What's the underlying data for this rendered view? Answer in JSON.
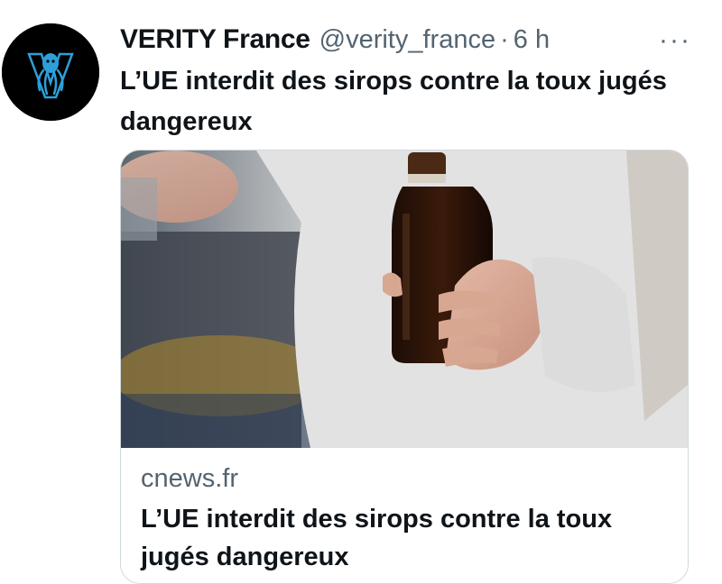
{
  "tweet": {
    "display_name": "VERITY France",
    "handle": "@verity_france",
    "separator": "·",
    "time": "6 h",
    "more_label": "···",
    "text": "L’UE interdit des sirops contre la toux jugés dangereux",
    "avatar_icon": "octopus-v-logo-icon"
  },
  "card": {
    "domain": "cnews.fr",
    "title": "L’UE interdit des sirops contre la toux jugés dangereux",
    "image_description_icon": "hand-holding-syrup-bottle-photo"
  },
  "colors": {
    "text_primary": "#0f1419",
    "text_secondary": "#536471",
    "card_border": "#cfd9de",
    "avatar_bg": "#000000",
    "logo_blue": "#2f9fd8"
  }
}
